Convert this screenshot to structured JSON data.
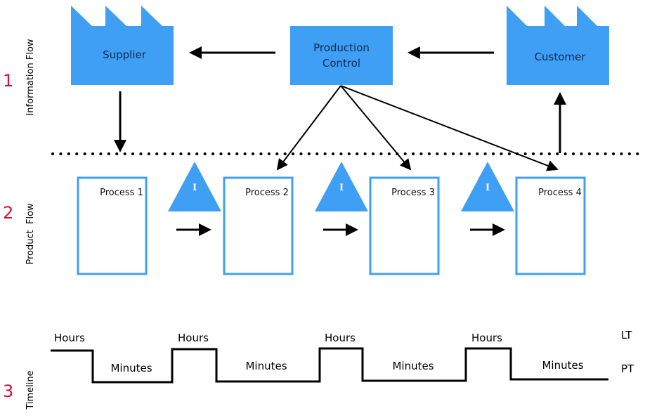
{
  "colors": {
    "accent": "#3f9ff5",
    "section_number": "#d0103a",
    "text_on_accent": "#0d2a52",
    "line": "#000000"
  },
  "sections": [
    {
      "number": "1",
      "label": "Information Flow"
    },
    {
      "number": "2",
      "label": "Product  Flow"
    },
    {
      "number": "3",
      "label": "Timeline"
    }
  ],
  "entities": {
    "supplier": {
      "label": "Supplier",
      "icon": "factory-icon"
    },
    "production_control": {
      "label_line1": "Production",
      "label_line2": "Control"
    },
    "customer": {
      "label": "Customer",
      "icon": "factory-icon"
    }
  },
  "processes": [
    "Process 1",
    "Process 2",
    "Process 3",
    "Process 4"
  ],
  "inventory": {
    "symbol": "I",
    "icon": "inventory-triangle-icon"
  },
  "timeline": {
    "lead_time_label": "LT",
    "process_time_label": "PT",
    "hours": [
      "Hours",
      "Hours",
      "Hours",
      "Hours"
    ],
    "minutes": [
      "Minutes",
      "Minutes",
      "Minutes",
      "Minutes"
    ]
  }
}
